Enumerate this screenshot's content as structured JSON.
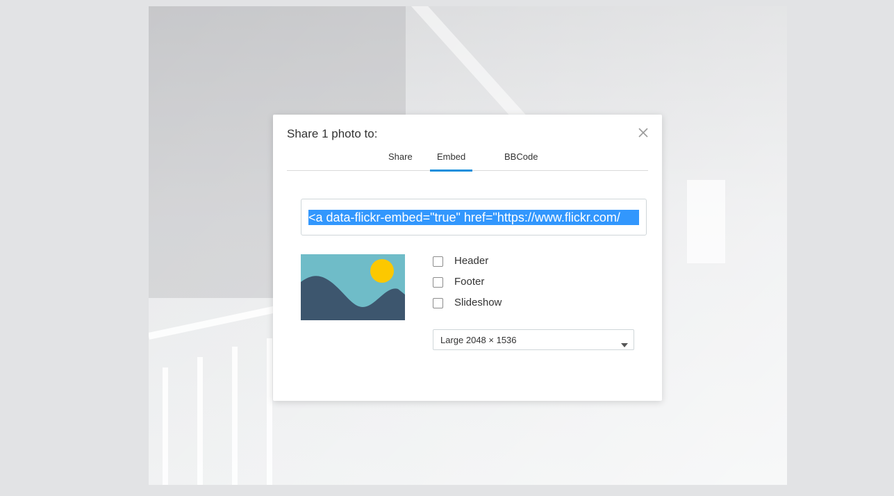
{
  "modal": {
    "title": "Share 1 photo to:",
    "tabs": [
      {
        "label": "Share",
        "active": false
      },
      {
        "label": "Embed",
        "active": true
      },
      {
        "label": "BBCode",
        "active": false
      }
    ],
    "embed_code": "<a data-flickr-embed=\"true\"  href=\"https://www.flickr.com/",
    "options": [
      {
        "label": "Header",
        "checked": false
      },
      {
        "label": "Footer",
        "checked": false
      },
      {
        "label": "Slideshow",
        "checked": false
      }
    ],
    "size_select": {
      "value": "Large 2048 × 1536"
    },
    "accent_color": "#128fdc",
    "selection_color": "#3297fd"
  }
}
